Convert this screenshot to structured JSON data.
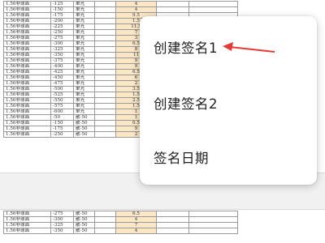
{
  "spec_table": {
    "rows": [
      {
        "type": "1.56非球面",
        "deg": "-125",
        "cyl": "单光",
        "qty": "4"
      },
      {
        "type": "1.56非球面",
        "deg": "-150",
        "cyl": "单光",
        "qty": "4"
      },
      {
        "type": "1.56非球面",
        "deg": "-175",
        "cyl": "单光",
        "qty": "9.5"
      },
      {
        "type": "1.56非球面",
        "deg": "-200",
        "cyl": "单光",
        "qty": "1.5"
      },
      {
        "type": "1.56非球面",
        "deg": "-225",
        "cyl": "单光",
        "qty": "11.5"
      },
      {
        "type": "1.56非球面",
        "deg": "-250",
        "cyl": "单光",
        "qty": "7"
      },
      {
        "type": "1.56非球面",
        "deg": "-275",
        "cyl": "单光",
        "qty": "3"
      },
      {
        "type": "1.56非球面",
        "deg": "-300",
        "cyl": "单光",
        "qty": "6.5"
      },
      {
        "type": "1.56非球面",
        "deg": "-325",
        "cyl": "单光",
        "qty": "8"
      },
      {
        "type": "1.56非球面",
        "deg": "-350",
        "cyl": "单光",
        "qty": "11"
      },
      {
        "type": "1.56非球面",
        "deg": "-375",
        "cyl": "单光",
        "qty": "9"
      },
      {
        "type": "1.56非球面",
        "deg": "-400",
        "cyl": "单光",
        "qty": "9"
      },
      {
        "type": "1.56非球面",
        "deg": "-425",
        "cyl": "单光",
        "qty": "6.5"
      },
      {
        "type": "1.56非球面",
        "deg": "-450",
        "cyl": "单光",
        "qty": "6"
      },
      {
        "type": "1.56非球面",
        "deg": "-475",
        "cyl": "单光",
        "qty": "2"
      },
      {
        "type": "1.56非球面",
        "deg": "-500",
        "cyl": "单光",
        "qty": "3.5"
      },
      {
        "type": "1.56非球面",
        "deg": "-525",
        "cyl": "单光",
        "qty": "1.5"
      },
      {
        "type": "1.56非球面",
        "deg": "-550",
        "cyl": "单光",
        "qty": "2.5"
      },
      {
        "type": "1.56非球面",
        "deg": "-575",
        "cyl": "单光",
        "qty": "1.5"
      },
      {
        "type": "1.56非球面",
        "deg": "-600",
        "cyl": "单光",
        "qty": "1"
      },
      {
        "type": "1.56非球面",
        "deg": "-50",
        "cyl": "散-50",
        "qty": "1"
      },
      {
        "type": "1.56非球面",
        "deg": "-150",
        "cyl": "散-50",
        "qty": "6.5"
      },
      {
        "type": "1.56非球面",
        "deg": "-175",
        "cyl": "散-50",
        "qty": "9"
      },
      {
        "type": "1.56非球面",
        "deg": "-250",
        "cyl": "散-50",
        "qty": "2"
      }
    ],
    "lower_rows": [
      {
        "type": "1.56非球面",
        "deg": "-275",
        "cyl": "散-50",
        "qty": "6.5"
      },
      {
        "type": "1.56非球面",
        "deg": "-300",
        "cyl": "散-50",
        "qty": "4"
      },
      {
        "type": "1.56非球面",
        "deg": "-325",
        "cyl": "散-50",
        "qty": "7"
      },
      {
        "type": "1.56非球面",
        "deg": "-350",
        "cyl": "散-50",
        "qty": "4"
      }
    ]
  },
  "context_menu": {
    "items": [
      {
        "label": "创建签名1"
      },
      {
        "label": "创建签名2"
      },
      {
        "label": "签名日期"
      }
    ]
  },
  "annotation": {
    "arrow_color": "#e53935"
  }
}
